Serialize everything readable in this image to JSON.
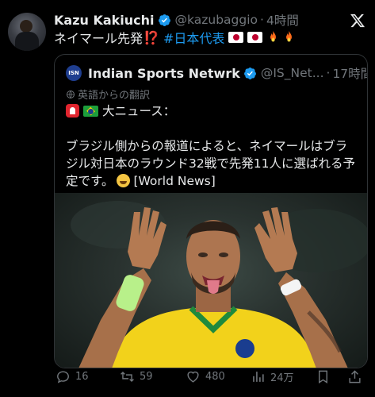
{
  "author": {
    "name": "Kazu Kakiuchi",
    "handle": "@kazubaggio",
    "separator": "·",
    "time": "4時間"
  },
  "tweet": {
    "text": "ネイマール先発",
    "exclaim": "⁉️",
    "hashtag": "#日本代表"
  },
  "quoted": {
    "logo_text": "ISN",
    "name": "Indian Sports Netwrk",
    "handle": "@IS_Net...",
    "separator": "·",
    "time": "17時間",
    "translated_label": "英語からの翻訳",
    "headline": "大ニュース：",
    "body_line1": "ブラジル側からの報道によると、ネイマールはブラ",
    "body_line2": "ジル対日本のラウンド32戦で先発11人に選ばれる予",
    "body_line3_pre": "定です。",
    "body_line3_post": "[World News]"
  },
  "actions": {
    "replies": "16",
    "reposts": "59",
    "likes": "480",
    "views": "24万"
  },
  "colors": {
    "background": "#000000",
    "text": "#e7e9ea",
    "secondary": "#71767b",
    "link": "#1d9bf0",
    "border": "#2f3336",
    "brazil_yellow": "#f2d21b"
  },
  "icons": [
    "verified-badge-icon",
    "x-logo-icon",
    "globe-icon",
    "reply-icon",
    "repost-icon",
    "like-icon",
    "views-icon",
    "bookmark-icon",
    "share-icon"
  ]
}
